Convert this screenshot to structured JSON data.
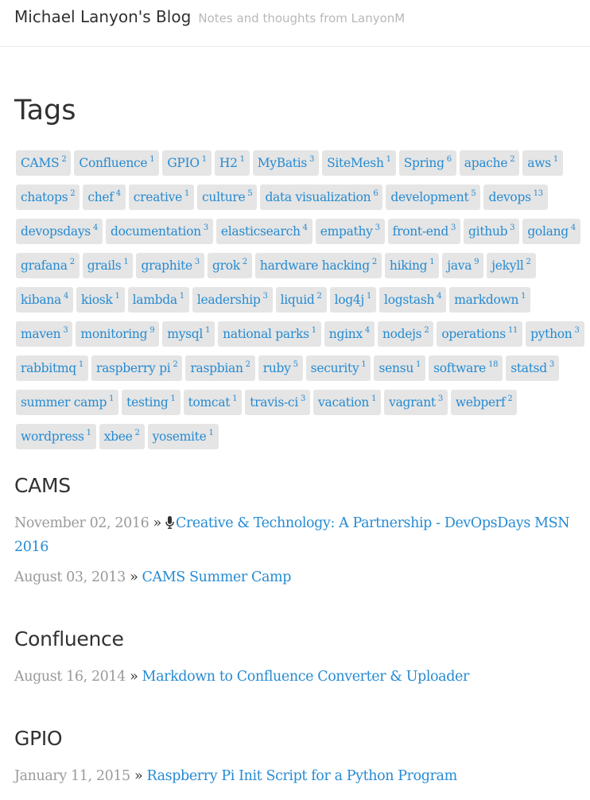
{
  "site": {
    "title": "Michael Lanyon's Blog",
    "tagline": "Notes and thoughts from LanyonM"
  },
  "page": {
    "title": "Tags"
  },
  "tags": [
    {
      "name": "CAMS",
      "count": "2"
    },
    {
      "name": "Confluence",
      "count": "1"
    },
    {
      "name": "GPIO",
      "count": "1"
    },
    {
      "name": "H2",
      "count": "1"
    },
    {
      "name": "MyBatis",
      "count": "3"
    },
    {
      "name": "SiteMesh",
      "count": "1"
    },
    {
      "name": "Spring",
      "count": "6"
    },
    {
      "name": "apache",
      "count": "2"
    },
    {
      "name": "aws",
      "count": "1"
    },
    {
      "name": "chatops",
      "count": "2"
    },
    {
      "name": "chef",
      "count": "4"
    },
    {
      "name": "creative",
      "count": "1"
    },
    {
      "name": "culture",
      "count": "5"
    },
    {
      "name": "data visualization",
      "count": "6"
    },
    {
      "name": "development",
      "count": "5"
    },
    {
      "name": "devops",
      "count": "13"
    },
    {
      "name": "devopsdays",
      "count": "4"
    },
    {
      "name": "documentation",
      "count": "3"
    },
    {
      "name": "elasticsearch",
      "count": "4"
    },
    {
      "name": "empathy",
      "count": "3"
    },
    {
      "name": "front-end",
      "count": "3"
    },
    {
      "name": "github",
      "count": "3"
    },
    {
      "name": "golang",
      "count": "4"
    },
    {
      "name": "grafana",
      "count": "2"
    },
    {
      "name": "grails",
      "count": "1"
    },
    {
      "name": "graphite",
      "count": "3"
    },
    {
      "name": "grok",
      "count": "2"
    },
    {
      "name": "hardware hacking",
      "count": "2"
    },
    {
      "name": "hiking",
      "count": "1"
    },
    {
      "name": "java",
      "count": "9"
    },
    {
      "name": "jekyll",
      "count": "2"
    },
    {
      "name": "kibana",
      "count": "4"
    },
    {
      "name": "kiosk",
      "count": "1"
    },
    {
      "name": "lambda",
      "count": "1"
    },
    {
      "name": "leadership",
      "count": "3"
    },
    {
      "name": "liquid",
      "count": "2"
    },
    {
      "name": "log4j",
      "count": "1"
    },
    {
      "name": "logstash",
      "count": "4"
    },
    {
      "name": "markdown",
      "count": "1"
    },
    {
      "name": "maven",
      "count": "3"
    },
    {
      "name": "monitoring",
      "count": "9"
    },
    {
      "name": "mysql",
      "count": "1"
    },
    {
      "name": "national parks",
      "count": "1"
    },
    {
      "name": "nginx",
      "count": "4"
    },
    {
      "name": "nodejs",
      "count": "2"
    },
    {
      "name": "operations",
      "count": "11"
    },
    {
      "name": "python",
      "count": "3"
    },
    {
      "name": "rabbitmq",
      "count": "1"
    },
    {
      "name": "raspberry pi",
      "count": "2"
    },
    {
      "name": "raspbian",
      "count": "2"
    },
    {
      "name": "ruby",
      "count": "5"
    },
    {
      "name": "security",
      "count": "1"
    },
    {
      "name": "sensu",
      "count": "1"
    },
    {
      "name": "software",
      "count": "18"
    },
    {
      "name": "statsd",
      "count": "3"
    },
    {
      "name": "summer camp",
      "count": "1"
    },
    {
      "name": "testing",
      "count": "1"
    },
    {
      "name": "tomcat",
      "count": "1"
    },
    {
      "name": "travis-ci",
      "count": "3"
    },
    {
      "name": "vacation",
      "count": "1"
    },
    {
      "name": "vagrant",
      "count": "3"
    },
    {
      "name": "webperf",
      "count": "2"
    },
    {
      "name": "wordpress",
      "count": "1"
    },
    {
      "name": "xbee",
      "count": "2"
    },
    {
      "name": "yosemite",
      "count": "1"
    }
  ],
  "sections": [
    {
      "heading": "CAMS",
      "posts": [
        {
          "date": "November 02, 2016",
          "separator": "»",
          "icon": "microphone-icon",
          "title": "Creative & Technology: A Partnership - DevOpsDays MSN 2016"
        },
        {
          "date": "August 03, 2013",
          "separator": "»",
          "title": "CAMS Summer Camp"
        }
      ]
    },
    {
      "heading": "Confluence",
      "posts": [
        {
          "date": "August 16, 2014",
          "separator": "»",
          "title": "Markdown to Confluence Converter & Uploader"
        }
      ]
    },
    {
      "heading": "GPIO",
      "posts": [
        {
          "date": "January 11, 2015",
          "separator": "»",
          "title": "Raspberry Pi Init Script for a Python Program"
        }
      ]
    }
  ],
  "colors": {
    "link": "#268bd2",
    "tag_background": "#e5e5e5",
    "date": "#9a9a9a",
    "tagline": "#b8b8b8",
    "text": "#313131"
  }
}
